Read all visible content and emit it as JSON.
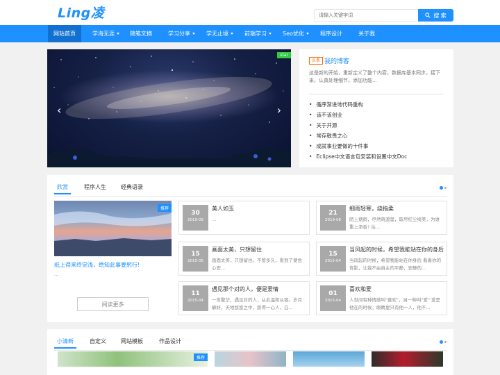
{
  "header": {
    "logo": "Ling凌",
    "search_placeholder": "请输入关键字词",
    "search_button": "搜 索"
  },
  "nav": {
    "items": [
      {
        "label": "网站首页",
        "dropdown": false,
        "active": true
      },
      {
        "label": "学海无涯",
        "dropdown": true
      },
      {
        "label": "随笔文摘",
        "dropdown": false
      },
      {
        "label": "学习分享",
        "dropdown": true
      },
      {
        "label": "学无止境",
        "dropdown": true
      },
      {
        "label": "前端学习",
        "dropdown": true
      },
      {
        "label": "Seo优化",
        "dropdown": true
      },
      {
        "label": "程序设计",
        "dropdown": false
      },
      {
        "label": "关于我",
        "dropdown": false
      }
    ]
  },
  "slider": {
    "tag": "star",
    "prev": "‹",
    "next": "›"
  },
  "blog": {
    "tag": "头条",
    "title": "我的博客",
    "desc": "这是新的开始，重新定义了整个内容，数据库基本同步。接下来，认真处理细节，添加功能...",
    "links": [
      "循序渐进地代码重构",
      "该不该创业",
      "关于开源",
      "常存敬畏之心",
      "成就事业要做的十件事",
      "Eclipse中文语言包安装和设置中文Doc"
    ]
  },
  "section1": {
    "tabs": [
      "欣赏",
      "程序人生",
      "经典语录"
    ],
    "feature": {
      "tag": "推荐",
      "title": "纸上得来终觉浅，绝知此事要躬行!",
      "ellipsis": "...",
      "more": "阅读更多"
    },
    "articles": [
      {
        "day": "30",
        "ym": "2019-09",
        "title": "美人如玉",
        "desc": "..."
      },
      {
        "day": "21",
        "ym": "2019-08",
        "title": "细雨轻寒，绕指柔",
        "desc": "陌上烟雨，尽然晓渡里，取尽红尘绮美，为谁重上添香? 往..."
      },
      {
        "day": "15",
        "ym": "2015-05",
        "title": "画面太美，只想留住",
        "desc": "画面太美，只想留住。不管多久，看到了便会心安..."
      },
      {
        "day": "15",
        "ym": "2015-04",
        "title": "当风起的时候，希望我能站在你的身后",
        "desc": "当风起的时候，希望我能站在你身后 看着你的背影，让我不由自主的平静，安静的..."
      },
      {
        "day": "11",
        "ym": "2015-04",
        "title": "遇见那个对的人，便是爱情",
        "desc": "一世繁华，遇见对的人，从此温和从容。岁月静好，天地悠悠之中，愿得一心人，白..."
      },
      {
        "day": "01",
        "ym": "2015-04",
        "title": "喜欢和爱",
        "desc": "人世间有种情感叫\"喜欢\"，另一种叫\"爱\" 爱是他在的时候，眼睛里只有他一人，他不..."
      }
    ]
  },
  "section2": {
    "tabs": [
      "小清新",
      "自定义",
      "网站模板",
      "作品设计"
    ],
    "thumb_tag": "推荐"
  },
  "colors": {
    "accent": "#1e90ff",
    "nav_active": "#1170d0",
    "slider_tag": "#2ecc40",
    "blog_tag": "#ff6600"
  }
}
